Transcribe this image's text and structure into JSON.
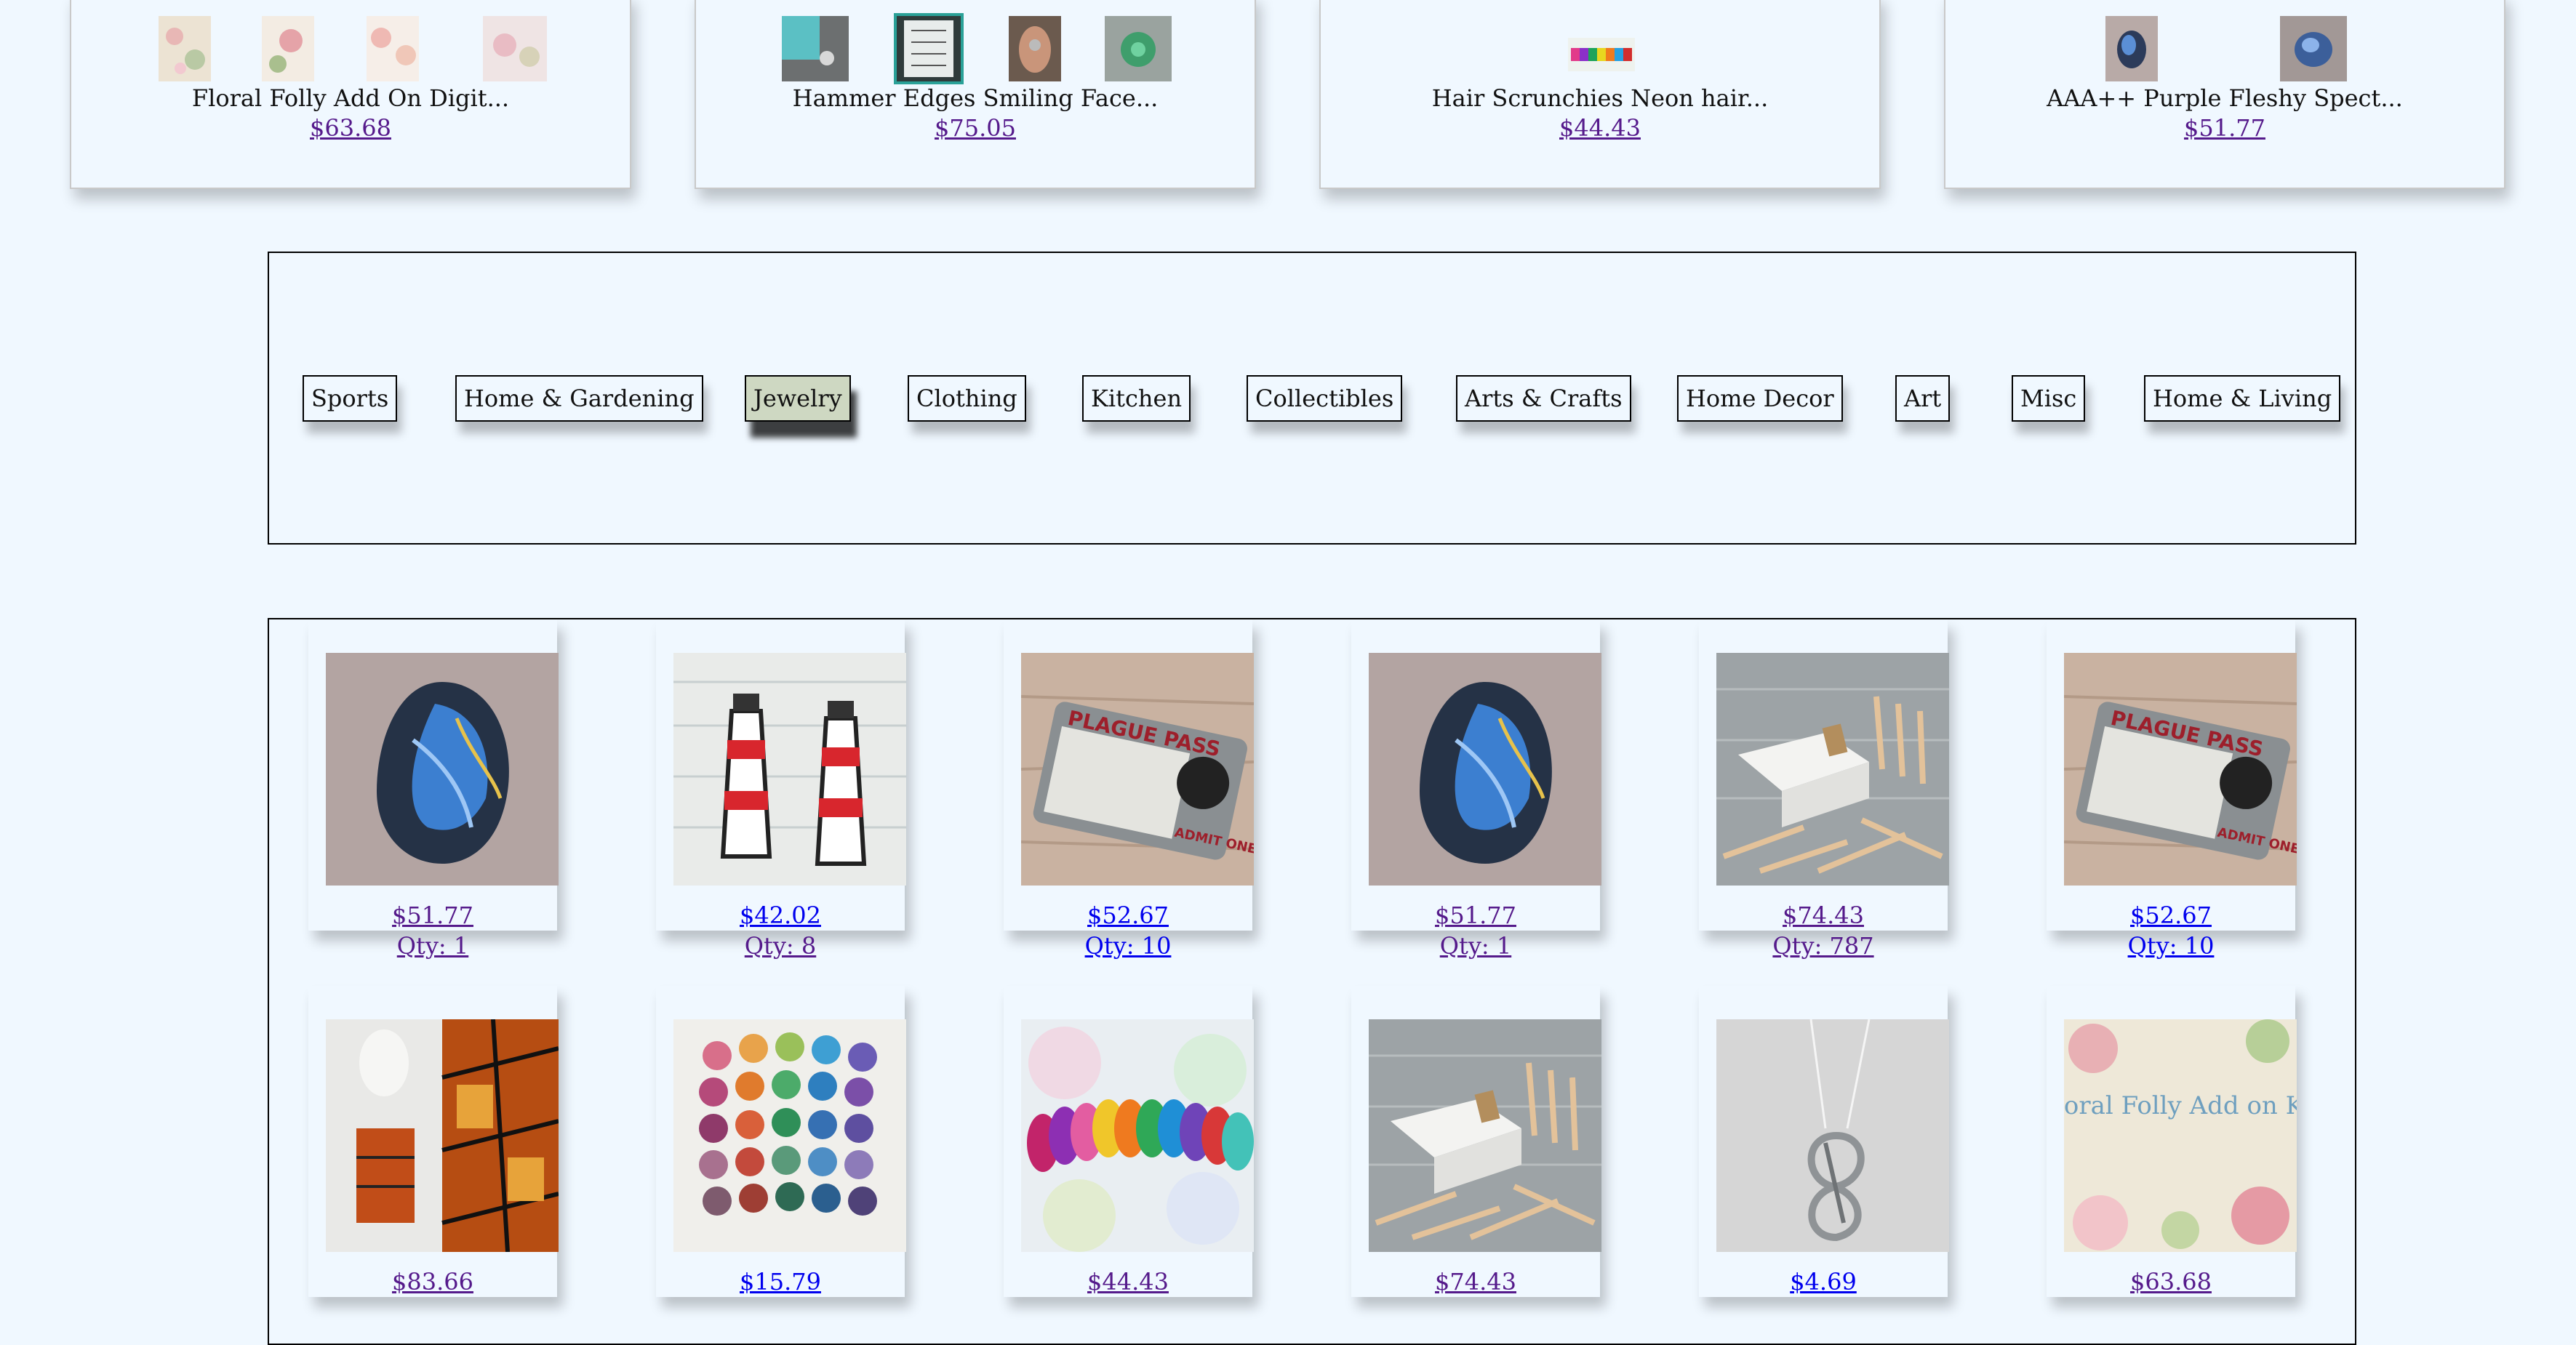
{
  "top_products": [
    {
      "title": "Floral Folly Add On Digit...",
      "price": "$63.68"
    },
    {
      "title": "Hammer Edges Smiling Face...",
      "price": "$75.05"
    },
    {
      "title": "Hair Scrunchies Neon hair...",
      "price": "$44.43"
    },
    {
      "title": "AAA++ Purple Fleshy Spect...",
      "price": "$51.77"
    }
  ],
  "categories": [
    {
      "label": "Sports"
    },
    {
      "label": "Home & Gardening"
    },
    {
      "label": "Jewelry",
      "active": true
    },
    {
      "label": "Clothing"
    },
    {
      "label": "Kitchen"
    },
    {
      "label": "Collectibles"
    },
    {
      "label": "Arts & Crafts"
    },
    {
      "label": "Home Decor"
    },
    {
      "label": "Art"
    },
    {
      "label": "Misc"
    },
    {
      "label": "Home & Living"
    }
  ],
  "products": [
    {
      "image": "labradorite-stone",
      "price": "$51.77",
      "qty": "Qty: 1"
    },
    {
      "image": "lighthouse-earrings",
      "price": "$42.02",
      "qty": "Qty: 8"
    },
    {
      "image": "plague-pass-card",
      "price": "$52.67",
      "qty": "Qty: 10"
    },
    {
      "image": "labradorite-stone",
      "price": "$51.77",
      "qty": "Qty: 1"
    },
    {
      "image": "golf-tees-box",
      "price": "$74.43",
      "qty": "Qty: 787"
    },
    {
      "image": "plague-pass-card",
      "price": "$52.67",
      "qty": "Qty: 10"
    },
    {
      "image": "tribal-skirt",
      "price": "$83.66",
      "qty": ""
    },
    {
      "image": "felt-balls",
      "price": "$15.79",
      "qty": ""
    },
    {
      "image": "scrunchies",
      "price": "$44.43",
      "qty": ""
    },
    {
      "image": "golf-tees-box",
      "price": "$74.43",
      "qty": ""
    },
    {
      "image": "lizard-necklace",
      "price": "$4.69",
      "qty": ""
    },
    {
      "image": "floral-kit",
      "price": "$63.68",
      "qty": ""
    }
  ],
  "product_images": {
    "floral_kit_text": "Floral Folly Add on Kit",
    "plague_pass_text": "PLAGUE PASS",
    "admit_one_text": "ADMIT ONE"
  },
  "colors": {
    "background": "#f0f8ff",
    "active_category": "#ced8c2",
    "link_visited": "#551a8b",
    "link_unvisited": "#0000ee"
  }
}
